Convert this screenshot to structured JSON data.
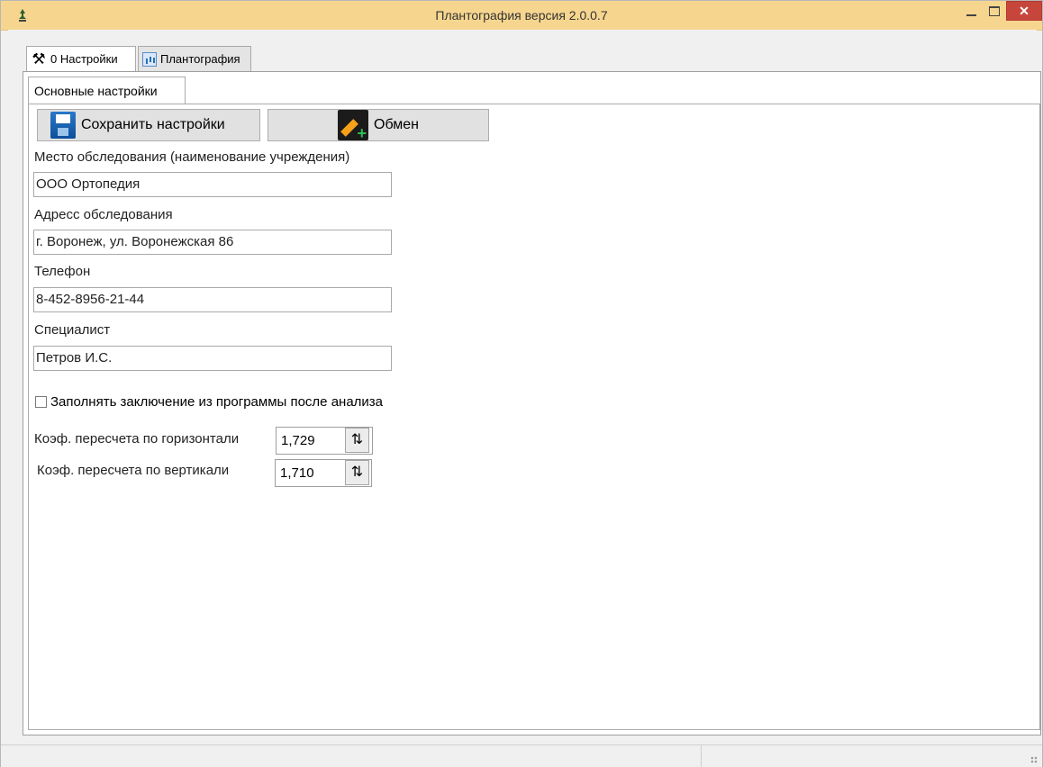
{
  "window": {
    "title": "Плантография версия 2.0.0.7"
  },
  "tabs": [
    {
      "label": "0 Настройки"
    },
    {
      "label": "Плантография"
    }
  ],
  "subtab": {
    "label": "Основные настройки"
  },
  "toolbar": {
    "save_label": "Сохранить настройки",
    "exchange_label": "Обмен"
  },
  "form": {
    "place": {
      "label": "Место обследования (наименование учреждения)",
      "value": "ООО Ортопедия"
    },
    "address": {
      "label": "Адресс обследования",
      "value": "г. Воронеж, ул. Воронежская 86"
    },
    "phone": {
      "label": "Телефон",
      "value": "8-452-8956-21-44"
    },
    "specialist": {
      "label": "Специалист",
      "value": "Петров И.С."
    },
    "fill_conclusion": {
      "label": "Заполнять заключение из программы после анализа",
      "checked": false
    },
    "coef_horizontal": {
      "label": "Коэф. пересчета по горизонтали",
      "value": "1,729"
    },
    "coef_vertical": {
      "label": "Коэф. пересчета по вертикали",
      "value": "1,710"
    }
  }
}
